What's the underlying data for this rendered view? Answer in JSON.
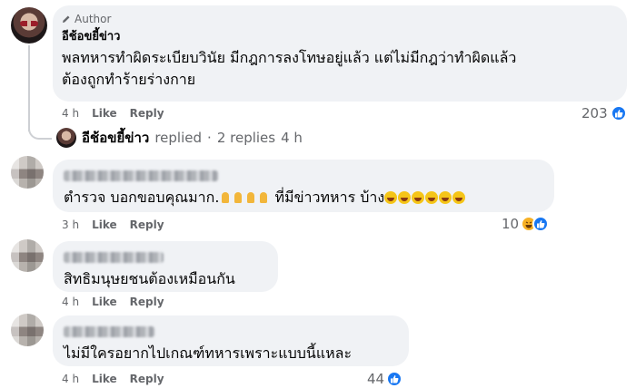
{
  "author_comment": {
    "badge": "Author",
    "name": "อีช้อขยี้ข่าว",
    "text_line1": "พลทหารทำผิดระเบียบวินัย มีกฎการลงโทษอยู่แล้ว แต่ไม่มีกฎว่าทำผิดแล้ว",
    "text_line2": "ต้องถูกทำร้ายร่างกาย",
    "time": "4 h",
    "like": "Like",
    "reply": "Reply",
    "reaction_count": "203"
  },
  "replies_summary": {
    "name": "อีช้อขยี้ข่าว",
    "replied": "replied",
    "dot": "·",
    "count": "2 replies",
    "time": "4 h"
  },
  "comments": [
    {
      "text_start": "ตำรวจ บอกขอบคุณมาก.",
      "text_mid": " ที่มีข่าวทหาร บ้าง",
      "time": "3 h",
      "like": "Like",
      "reply": "Reply",
      "reaction_count": "10"
    },
    {
      "text": "สิทธิมนุษยชนต้องเหมือนกัน",
      "time": "4 h",
      "like": "Like",
      "reply": "Reply"
    },
    {
      "text": "ไม่มีใครอยากไปเกณฑ์ทหารเพราะแบบนี้แหละ",
      "time": "4 h",
      "like": "Like",
      "reply": "Reply",
      "reaction_count": "44"
    }
  ],
  "icons": {
    "like": "like-thumb-icon",
    "haha": "haha-face-icon",
    "pencil": "pencil-icon",
    "pray": "folded-hands-emoji",
    "laugh": "laughing-emoji"
  },
  "colors": {
    "like_blue": "#1877f2",
    "bubble": "#f0f2f5",
    "meta_gray": "#65676b"
  }
}
